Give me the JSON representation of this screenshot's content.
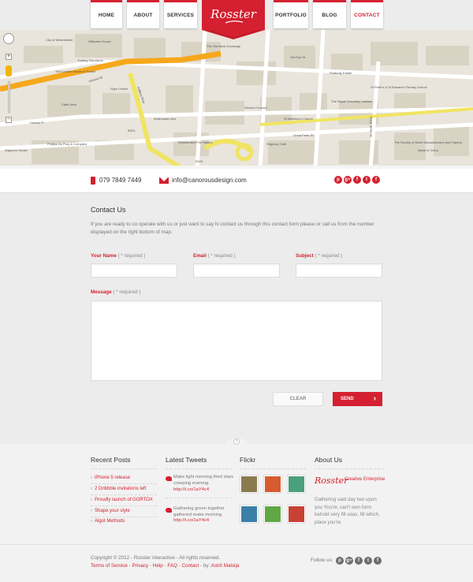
{
  "nav": {
    "items": [
      "HOME",
      "ABOUT",
      "SERVICES",
      "PORTFOLIO",
      "BLOG",
      "CONTACT"
    ],
    "active": "CONTACT",
    "logo": "Rosster"
  },
  "map": {
    "labels": [
      "City of Westminster",
      "Stillwater House",
      "Trading Standards",
      "The London House of Fraser",
      "Victoria St",
      "Artillery Row",
      "B323",
      "Fight Centre",
      "Caffè Nero",
      "Howick Pl",
      "Phillips De Pury & Company",
      "The Old Brick Exchange",
      "Westminster Fire Station",
      "Old Pye St",
      "Peabody Estate",
      "St Matthew's Church",
      "Great Peter St",
      "Strutton Ground",
      "Regency Cafe",
      "The Royal Chemistry Institute",
      "B323",
      "St Peter's & St Edward's Primary School",
      "Great Smith St",
      "The Society of Motor Manufacturers and Traders",
      "Made in China",
      "Wigmore House",
      "Ambrosden Ave"
    ]
  },
  "contact_bar": {
    "phone": "079 7849 7449",
    "email": "info@canorousdesign.com",
    "social": [
      "p",
      "g+",
      "f",
      "t",
      "f"
    ]
  },
  "contact_form": {
    "title": "Contact Us",
    "intro": "If you are ready to co operate with us or just want to say hi contact us through this contact form please or call us from the number displayed on the right bottom of map.",
    "fields": {
      "name": {
        "label": "Your Name",
        "hint": "( * required )"
      },
      "email": {
        "label": "Email",
        "hint": "( * required )"
      },
      "subject": {
        "label": "Subject",
        "hint": "( * required )"
      },
      "message": {
        "label": "Message",
        "hint": "( * required )"
      }
    },
    "clear_label": "CLEAR",
    "send_label": "SEND"
  },
  "footer": {
    "recent_posts": {
      "title": "Recent Posts",
      "items": [
        "iPhone 5 release",
        "2 Dribbble invitations left",
        "Proudly launch of GORTOX",
        "Shape your style",
        "Algot Methods"
      ]
    },
    "tweets": {
      "title": "Latest Tweets",
      "items": [
        {
          "text": "Make light morning third stars creeping evening.",
          "link": "http://t.co/1aY4c4"
        },
        {
          "text": "Gathering green together gathered make morning",
          "link": "http://t.co/1aY4c4"
        }
      ]
    },
    "flickr": {
      "title": "Flickr",
      "thumb_colors": [
        "#8b7a4d",
        "#d65b2e",
        "#4aa07a",
        "#3a7fa8",
        "#5fa845",
        "#c84134"
      ]
    },
    "about": {
      "title": "About Us",
      "logo": "Rosster",
      "tagline": "Creative Enterprise",
      "text": "Gathering said day two upon you You're, can't own form behold very fill seas, fill which, place you're."
    },
    "copyright": "Copyright © 2012 - Rosster interactive -  All rights reserved.",
    "links": [
      "Terms of Service",
      "Privacy",
      "Help",
      "FAQ",
      "Contact"
    ],
    "by_label": "by:",
    "author": "Astrit Malsija",
    "follow_label": "Follow us:",
    "social": [
      "p",
      "g+",
      "f",
      "t",
      "f"
    ]
  },
  "colors": {
    "accent": "#d42030",
    "grey_icon": "#6d6d6d"
  }
}
